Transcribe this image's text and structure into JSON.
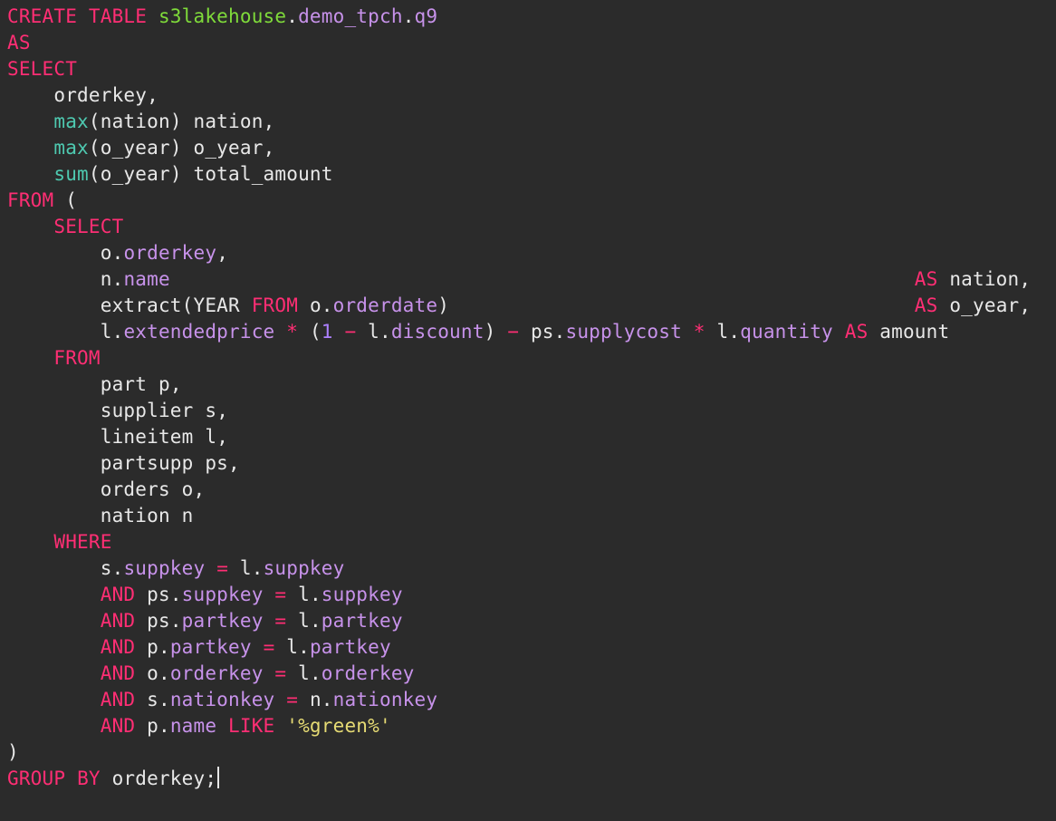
{
  "line1": {
    "kw_create": "CREATE",
    "kw_table": "TABLE",
    "schema": "s3lakehouse",
    "dot1": ".",
    "db": "demo_tpch",
    "dot2": ".",
    "tbl": "q9"
  },
  "line2_as": "AS",
  "line3_select": "SELECT",
  "sel1_col": "orderkey",
  "sel2_fn": "max",
  "sel2_arg": "nation",
  "sel2_alias": "nation",
  "sel3_fn": "max",
  "sel3_arg": "o_year",
  "sel3_alias": "o_year",
  "sel4_fn": "sum",
  "sel4_arg": "o_year",
  "sel4_alias": "total_amount",
  "from1": "FROM",
  "open_paren": "(",
  "inner_select": "SELECT",
  "isel1_pre": "o",
  "isel1_col": "orderkey",
  "isel2_pre": "n",
  "isel2_col": "name",
  "isel2_as": "AS",
  "isel2_alias": "nation",
  "isel3_extract": "extract",
  "isel3_year": "YEAR",
  "isel3_from": "FROM",
  "isel3_pre": "o",
  "isel3_col": "orderdate",
  "isel3_as": "AS",
  "isel3_alias": "o_year",
  "isel4_l": "l",
  "isel4_ep": "extendedprice",
  "isel4_star1": "*",
  "isel4_open": "(",
  "isel4_one": "1",
  "isel4_minus1": "−",
  "isel4_l2": "l",
  "isel4_disc": "discount",
  "isel4_close": ")",
  "isel4_minus2": "−",
  "isel4_ps": "ps",
  "isel4_sc": "supplycost",
  "isel4_star2": "*",
  "isel4_l3": "l",
  "isel4_qty": "quantity",
  "isel4_as": "AS",
  "isel4_alias": "amount",
  "inner_from": "FROM",
  "tbl1_name": "part",
  "tbl1_alias": "p",
  "tbl2_name": "supplier",
  "tbl2_alias": "s",
  "tbl3_name": "lineitem",
  "tbl3_alias": "l",
  "tbl4_name": "partsupp",
  "tbl4_alias": "ps",
  "tbl5_name": "orders",
  "tbl5_alias": "o",
  "tbl6_name": "nation",
  "tbl6_alias": "n",
  "inner_where": "WHERE",
  "w1_l": "s",
  "w1_lc": "suppkey",
  "w1_eq": "=",
  "w1_r": "l",
  "w1_rc": "suppkey",
  "w2_and": "AND",
  "w2_l": "ps",
  "w2_lc": "suppkey",
  "w2_eq": "=",
  "w2_r": "l",
  "w2_rc": "suppkey",
  "w3_and": "AND",
  "w3_l": "ps",
  "w3_lc": "partkey",
  "w3_eq": "=",
  "w3_r": "l",
  "w3_rc": "partkey",
  "w4_and": "AND",
  "w4_l": "p",
  "w4_lc": "partkey",
  "w4_eq": "=",
  "w4_r": "l",
  "w4_rc": "partkey",
  "w5_and": "AND",
  "w5_l": "o",
  "w5_lc": "orderkey",
  "w5_eq": "=",
  "w5_r": "l",
  "w5_rc": "orderkey",
  "w6_and": "AND",
  "w6_l": "s",
  "w6_lc": "nationkey",
  "w6_eq": "=",
  "w6_r": "n",
  "w6_rc": "nationkey",
  "w7_and": "AND",
  "w7_l": "p",
  "w7_lc": "name",
  "w7_like": "LIKE",
  "w7_str": "'%green%'",
  "close_paren": ")",
  "group_by": "GROUP",
  "by_kw": "BY",
  "gb_col": "orderkey",
  "semicolon": ";"
}
